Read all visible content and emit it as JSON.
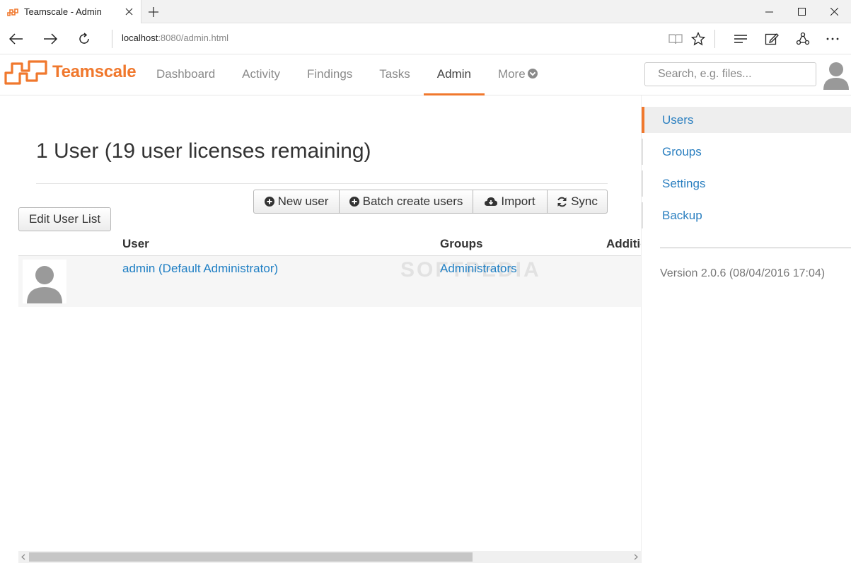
{
  "browser": {
    "tab_title": "Teamscale - Admin",
    "url_host": "localhost",
    "url_rest": ":8080/admin.html"
  },
  "app": {
    "brand": "Teamscale",
    "brand_color": "#f0782d",
    "nav": [
      {
        "label": "Dashboard"
      },
      {
        "label": "Activity"
      },
      {
        "label": "Findings"
      },
      {
        "label": "Tasks"
      },
      {
        "label": "Admin",
        "active": true
      },
      {
        "label": "More"
      }
    ],
    "search_placeholder": "Search, e.g. files..."
  },
  "sidebar": {
    "items": [
      {
        "label": "Users",
        "active": true
      },
      {
        "label": "Groups"
      },
      {
        "label": "Settings"
      },
      {
        "label": "Backup"
      }
    ],
    "version": "Version 2.0.6 (08/04/2016 17:04)"
  },
  "main": {
    "heading": "1 User (19 user licenses remaining)",
    "actions": {
      "new_user": "New user",
      "batch_create": "Batch create users",
      "import": "Import",
      "sync": "Sync"
    },
    "edit_list": "Edit User List",
    "columns": [
      "User",
      "Groups",
      "Additio"
    ],
    "rows": [
      {
        "user": "admin (Default Administrator)",
        "groups": "Administrators"
      }
    ],
    "watermark": "SOFTPEDIA"
  }
}
